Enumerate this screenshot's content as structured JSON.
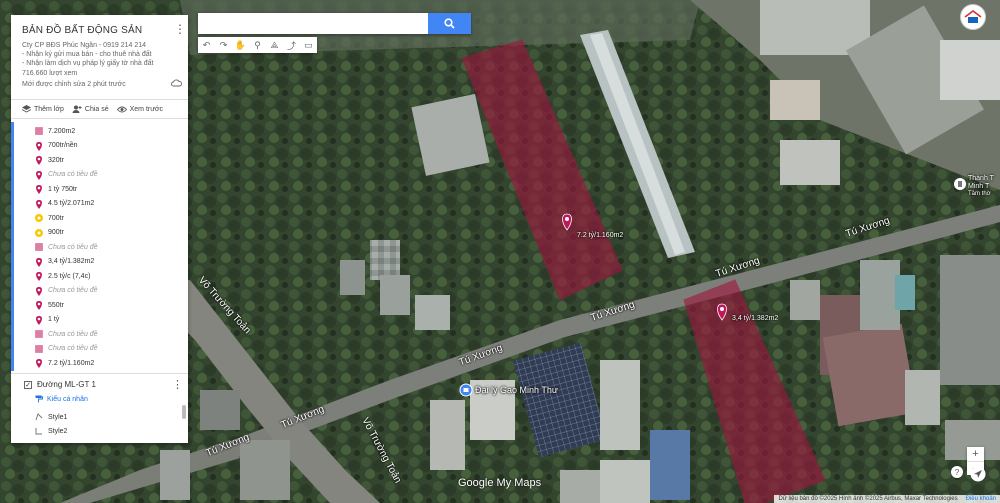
{
  "panel": {
    "title": "BẢN ĐỒ BẤT ĐỘNG SẢN",
    "description": [
      "Cty CP BĐS Phúc Ngân - 0919 214 214",
      "- Nhận ký gửi mua bán - cho thuê nhà đất",
      "- Nhận làm dịch vụ pháp lý giấy tờ nhà đất"
    ],
    "views": "716.660 lượt xem",
    "edited": "Mới được chỉnh sửa 2 phút trước",
    "actions": {
      "add_layer": "Thêm lớp",
      "share": "Chia sẻ",
      "preview": "Xem trước"
    },
    "items": [
      {
        "label": "7.200m2",
        "icon": "polygon-icon",
        "color": "#c2185b",
        "muted": false
      },
      {
        "label": "700tr/nền",
        "icon": "pin-icon",
        "color": "#c2185b",
        "muted": false
      },
      {
        "label": "320tr",
        "icon": "pin-icon",
        "color": "#c2185b",
        "muted": false
      },
      {
        "label": "Chưa có tiêu đề",
        "icon": "pin-icon",
        "color": "#c2185b",
        "muted": true
      },
      {
        "label": "1 tỷ 750tr",
        "icon": "pin-icon",
        "color": "#c2185b",
        "muted": false
      },
      {
        "label": "4.5 tỷ/2.071m2",
        "icon": "pin-icon",
        "color": "#c2185b",
        "muted": false
      },
      {
        "label": "700tr",
        "icon": "circle-icon",
        "color": "#f9c700",
        "muted": false
      },
      {
        "label": "900tr",
        "icon": "circle-icon",
        "color": "#f9c700",
        "muted": false
      },
      {
        "label": "Chưa có tiêu đề",
        "icon": "polygon-icon",
        "color": "#c2185b",
        "muted": true
      },
      {
        "label": "3,4 tỷ/1.382m2",
        "icon": "pin-icon",
        "color": "#c2185b",
        "muted": false
      },
      {
        "label": "2.5 tỷ/c (7,4c)",
        "icon": "pin-icon",
        "color": "#c2185b",
        "muted": false
      },
      {
        "label": "Chưa có tiêu đề",
        "icon": "pin-icon",
        "color": "#c2185b",
        "muted": true
      },
      {
        "label": "550tr",
        "icon": "pin-icon",
        "color": "#c2185b",
        "muted": false
      },
      {
        "label": "1 tỷ",
        "icon": "pin-icon",
        "color": "#c2185b",
        "muted": false
      },
      {
        "label": "Chưa có tiêu đề",
        "icon": "polygon-icon",
        "color": "#c2185b",
        "muted": true
      },
      {
        "label": "Chưa có tiêu đề",
        "icon": "polygon-icon",
        "color": "#c2185b",
        "muted": true
      },
      {
        "label": "7.2 tỷ/1.160m2",
        "icon": "pin-icon",
        "color": "#c2185b",
        "muted": false
      }
    ],
    "layer2": {
      "name": "Đường ML-GT 1",
      "style_link": "Kiểu cá nhân",
      "styles": [
        "Style1",
        "Style2"
      ]
    }
  },
  "search": {
    "placeholder": "",
    "value": ""
  },
  "toolbar": [
    "undo-icon",
    "redo-icon",
    "hand-icon",
    "marker-icon",
    "polyline-icon",
    "directions-icon",
    "ruler-icon"
  ],
  "map": {
    "road_labels": [
      "Tú Xương",
      "Tú Xương",
      "Tú Xương",
      "Tú Xương",
      "Tú Xương",
      "Tú Xương",
      "Võ Trường Toản",
      "Võ Trường Toản"
    ],
    "markers": [
      "7.2 tỷ/1.160m2",
      "3,4 tỷ/1.382m2"
    ],
    "poi": "Đại lý Gạo Minh Thư",
    "poi_right": [
      "Thành T",
      "Minh T",
      "Tâm thờ"
    ],
    "overlay_color": "#a0153e"
  },
  "footer": {
    "logo": "Google My Maps",
    "attribution": "Dữ liệu bản đồ ©2025 Hình ảnh ©2025 Airbus, Maxar Technologies",
    "terms": "Điều khoản"
  },
  "controls": {
    "zoom_in": "+",
    "zoom_out": "−",
    "help": "?"
  }
}
